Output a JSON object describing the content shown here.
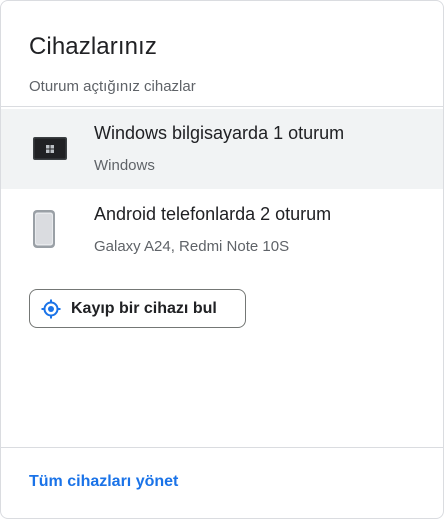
{
  "header": {
    "title": "Cihazlarınız",
    "subtitle": "Oturum açtığınız cihazlar"
  },
  "devices": [
    {
      "name": "Windows bilgisayarda 1 oturum",
      "detail": "Windows",
      "icon": "laptop-icon"
    },
    {
      "name": "Android telefonlarda 2 oturum",
      "detail": "Galaxy A24, Redmi Note 10S",
      "icon": "smartphone-icon"
    }
  ],
  "find_device": {
    "label": "Kayıp bir cihazı bul",
    "icon": "location-target-icon"
  },
  "footer": {
    "manage_link": "Tüm cihazları yönet"
  },
  "colors": {
    "accent": "#1a73e8",
    "text_primary": "#202124",
    "text_secondary": "#5f6368",
    "row_highlight": "#f1f3f4",
    "border": "#dadce0"
  }
}
